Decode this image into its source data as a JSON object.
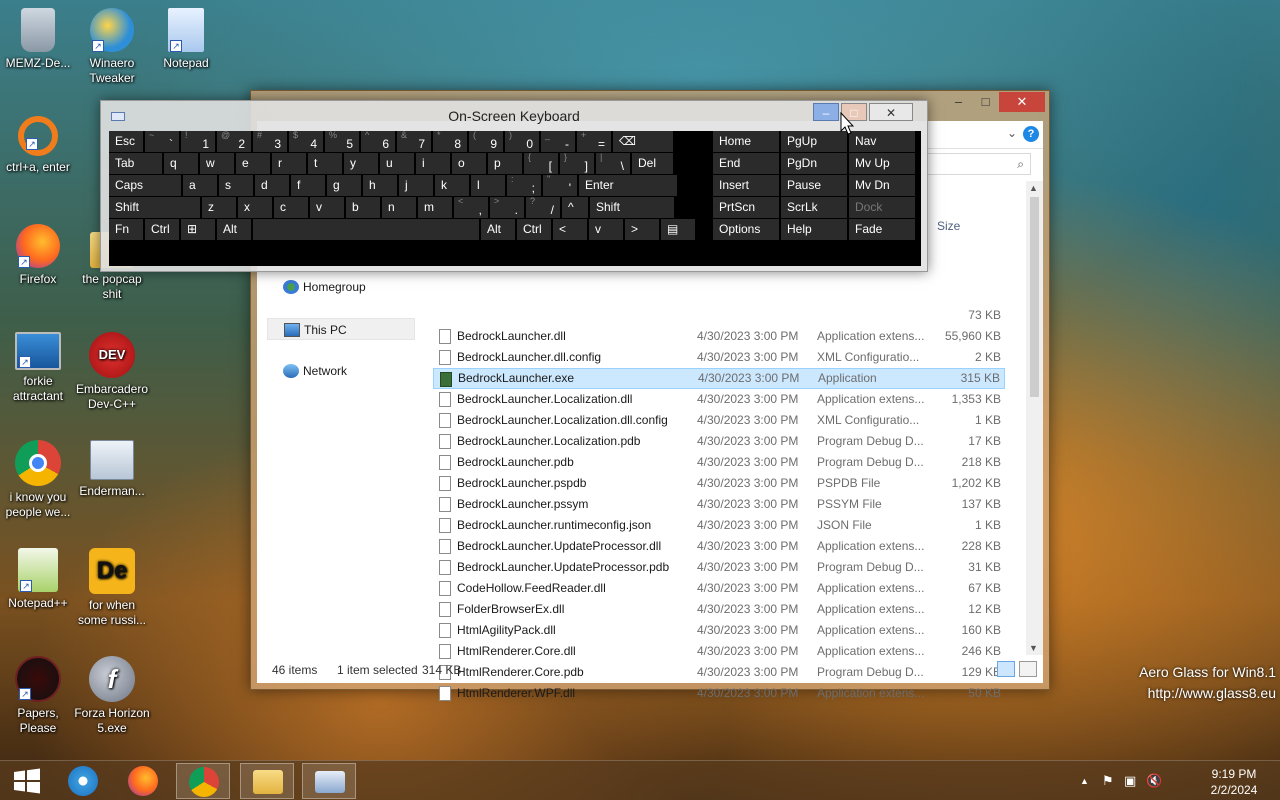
{
  "desktop_icons": [
    {
      "label": "MEMZ-De...",
      "icon": "recycle-bin-icon"
    },
    {
      "label": "Winaero Tweaker",
      "icon": "winaero-icon"
    },
    {
      "label": "Notepad",
      "icon": "notepad-icon"
    },
    {
      "label": "ctrl+a, enter",
      "icon": "ring-icon"
    },
    {
      "label": "Firefox",
      "icon": "firefox-icon"
    },
    {
      "label": "the popcap shit",
      "icon": "folder-icon"
    },
    {
      "label": "forkie attractant",
      "icon": "computer-gear-icon"
    },
    {
      "label": "Embarcadero Dev-C++",
      "icon": "devcpp-icon"
    },
    {
      "label": "i know you people we...",
      "icon": "chrome-icon"
    },
    {
      "label": "Enderman...",
      "icon": "screenshot-icon"
    },
    {
      "label": "Notepad++",
      "icon": "notepadpp-icon"
    },
    {
      "label": "for when some russi...",
      "icon": "de-icon"
    },
    {
      "label": "Papers, Please",
      "icon": "papers-please-icon"
    },
    {
      "label": "Forza Horizon 5.exe",
      "icon": "flash-icon"
    }
  ],
  "explorer": {
    "caption": {
      "minimize": "–",
      "maximize": "□",
      "close": "✕"
    },
    "help": "?",
    "size_header": "Size",
    "nav": {
      "homegroup": "Homegroup",
      "this_pc": "This PC",
      "network": "Network"
    },
    "partial_row_size": "73 KB",
    "files": [
      {
        "name": "BedrockLauncher.dll",
        "date": "4/30/2023 3:00 PM",
        "type": "Application extens...",
        "size": "55,960 KB"
      },
      {
        "name": "BedrockLauncher.dll.config",
        "date": "4/30/2023 3:00 PM",
        "type": "XML Configuratio...",
        "size": "2 KB"
      },
      {
        "name": "BedrockLauncher.exe",
        "date": "4/30/2023 3:00 PM",
        "type": "Application",
        "size": "315 KB"
      },
      {
        "name": "BedrockLauncher.Localization.dll",
        "date": "4/30/2023 3:00 PM",
        "type": "Application extens...",
        "size": "1,353 KB"
      },
      {
        "name": "BedrockLauncher.Localization.dll.config",
        "date": "4/30/2023 3:00 PM",
        "type": "XML Configuratio...",
        "size": "1 KB"
      },
      {
        "name": "BedrockLauncher.Localization.pdb",
        "date": "4/30/2023 3:00 PM",
        "type": "Program Debug D...",
        "size": "17 KB"
      },
      {
        "name": "BedrockLauncher.pdb",
        "date": "4/30/2023 3:00 PM",
        "type": "Program Debug D...",
        "size": "218 KB"
      },
      {
        "name": "BedrockLauncher.pspdb",
        "date": "4/30/2023 3:00 PM",
        "type": "PSPDB File",
        "size": "1,202 KB"
      },
      {
        "name": "BedrockLauncher.pssym",
        "date": "4/30/2023 3:00 PM",
        "type": "PSSYM File",
        "size": "137 KB"
      },
      {
        "name": "BedrockLauncher.runtimeconfig.json",
        "date": "4/30/2023 3:00 PM",
        "type": "JSON File",
        "size": "1 KB"
      },
      {
        "name": "BedrockLauncher.UpdateProcessor.dll",
        "date": "4/30/2023 3:00 PM",
        "type": "Application extens...",
        "size": "228 KB"
      },
      {
        "name": "BedrockLauncher.UpdateProcessor.pdb",
        "date": "4/30/2023 3:00 PM",
        "type": "Program Debug D...",
        "size": "31 KB"
      },
      {
        "name": "CodeHollow.FeedReader.dll",
        "date": "4/30/2023 3:00 PM",
        "type": "Application extens...",
        "size": "67 KB"
      },
      {
        "name": "FolderBrowserEx.dll",
        "date": "4/30/2023 3:00 PM",
        "type": "Application extens...",
        "size": "12 KB"
      },
      {
        "name": "HtmlAgilityPack.dll",
        "date": "4/30/2023 3:00 PM",
        "type": "Application extens...",
        "size": "160 KB"
      },
      {
        "name": "HtmlRenderer.Core.dll",
        "date": "4/30/2023 3:00 PM",
        "type": "Application extens...",
        "size": "246 KB"
      },
      {
        "name": "HtmlRenderer.Core.pdb",
        "date": "4/30/2023 3:00 PM",
        "type": "Program Debug D...",
        "size": "129 KB"
      },
      {
        "name": "HtmlRenderer.WPF.dll",
        "date": "4/30/2023 3:00 PM",
        "type": "Application extens...",
        "size": "50 KB"
      }
    ],
    "selected_file": "BedrockLauncher.exe",
    "status": {
      "items": "46 items",
      "selected": "1 item selected",
      "selected_size": "314 KB"
    }
  },
  "osk": {
    "title": "On-Screen Keyboard",
    "caption": {
      "minimize": "–",
      "maximize": "□",
      "close": "✕"
    },
    "rows": [
      [
        {
          "label": "Esc",
          "w": 36
        },
        {
          "sub": "~",
          "label": "`",
          "w": 36
        },
        {
          "sub": "!",
          "label": "1",
          "w": 36
        },
        {
          "sub": "@",
          "label": "2",
          "w": 36
        },
        {
          "sub": "#",
          "label": "3",
          "w": 36
        },
        {
          "sub": "$",
          "label": "4",
          "w": 36
        },
        {
          "sub": "%",
          "label": "5",
          "w": 36
        },
        {
          "sub": "^",
          "label": "6",
          "w": 36
        },
        {
          "sub": "&",
          "label": "7",
          "w": 36
        },
        {
          "sub": "*",
          "label": "8",
          "w": 36
        },
        {
          "sub": "(",
          "label": "9",
          "w": 36
        },
        {
          "sub": ")",
          "label": "0",
          "w": 36
        },
        {
          "sub": "_",
          "label": "-",
          "w": 36
        },
        {
          "sub": "+",
          "label": "=",
          "w": 36
        },
        {
          "label": "⌫",
          "w": 62
        }
      ],
      [
        {
          "label": "Tab",
          "w": 55
        },
        {
          "label": "q",
          "w": 36
        },
        {
          "label": "w",
          "w": 36
        },
        {
          "label": "e",
          "w": 36
        },
        {
          "label": "r",
          "w": 36
        },
        {
          "label": "t",
          "w": 36
        },
        {
          "label": "y",
          "w": 36
        },
        {
          "label": "u",
          "w": 36
        },
        {
          "label": "i",
          "w": 36
        },
        {
          "label": "o",
          "w": 36
        },
        {
          "label": "p",
          "w": 36
        },
        {
          "sub": "{",
          "label": "[",
          "w": 36
        },
        {
          "sub": "}",
          "label": "]",
          "w": 36
        },
        {
          "sub": "|",
          "label": "\\",
          "w": 36
        },
        {
          "label": "Del",
          "w": 43
        }
      ],
      [
        {
          "label": "Caps",
          "w": 74
        },
        {
          "label": "a",
          "w": 36
        },
        {
          "label": "s",
          "w": 36
        },
        {
          "label": "d",
          "w": 36
        },
        {
          "label": "f",
          "w": 36
        },
        {
          "label": "g",
          "w": 36
        },
        {
          "label": "h",
          "w": 36
        },
        {
          "label": "j",
          "w": 36
        },
        {
          "label": "k",
          "w": 36
        },
        {
          "label": "l",
          "w": 36
        },
        {
          "sub": ":",
          "label": ";",
          "w": 36
        },
        {
          "sub": "\"",
          "label": "'",
          "w": 36
        },
        {
          "label": "Enter",
          "w": 100
        }
      ],
      [
        {
          "label": "Shift",
          "w": 93
        },
        {
          "label": "z",
          "w": 36
        },
        {
          "label": "x",
          "w": 36
        },
        {
          "label": "c",
          "w": 36
        },
        {
          "label": "v",
          "w": 36
        },
        {
          "label": "b",
          "w": 36
        },
        {
          "label": "n",
          "w": 36
        },
        {
          "label": "m",
          "w": 36
        },
        {
          "sub": "<",
          "label": ",",
          "w": 36
        },
        {
          "sub": ">",
          "label": ".",
          "w": 36
        },
        {
          "sub": "?",
          "label": "/",
          "w": 36
        },
        {
          "label": "^",
          "w": 28
        },
        {
          "label": "Shift",
          "w": 86
        }
      ],
      [
        {
          "label": "Fn",
          "w": 36
        },
        {
          "label": "Ctrl",
          "w": 36
        },
        {
          "label": "⊞",
          "w": 36
        },
        {
          "label": "Alt",
          "w": 36
        },
        {
          "label": "",
          "w": 228
        },
        {
          "label": "Alt",
          "w": 36
        },
        {
          "label": "Ctrl",
          "w": 36
        },
        {
          "label": "<",
          "w": 36
        },
        {
          "label": "v",
          "w": 36
        },
        {
          "label": ">",
          "w": 36
        },
        {
          "label": "▤",
          "w": 36
        }
      ]
    ],
    "nav_keys": [
      [
        "Home",
        "PgUp",
        "Nav"
      ],
      [
        "End",
        "PgDn",
        "Mv Up"
      ],
      [
        "Insert",
        "Pause",
        "Mv Dn"
      ],
      [
        "PrtScn",
        "ScrLk",
        "Dock"
      ],
      [
        "Options",
        "Help",
        "Fade"
      ]
    ]
  },
  "watermark": {
    "line1": "Aero Glass for Win8.1",
    "line2": "http://www.glass8.eu"
  },
  "taskbar": {
    "items": [
      {
        "name": "start-button",
        "icon": "windows-logo-icon"
      },
      {
        "name": "taskbar-ie",
        "icon": "internet-explorer-icon"
      },
      {
        "name": "taskbar-firefox",
        "icon": "firefox-icon"
      },
      {
        "name": "taskbar-chrome",
        "icon": "chrome-icon"
      },
      {
        "name": "taskbar-file-explorer",
        "icon": "folder-icon"
      },
      {
        "name": "taskbar-osk",
        "icon": "keyboard-icon"
      }
    ],
    "clock": {
      "time": "9:19 PM",
      "date": "2/2/2024"
    },
    "tray": {
      "chevron": "▲",
      "flag": "⚑",
      "network": "▣",
      "volume": "🔇"
    }
  }
}
